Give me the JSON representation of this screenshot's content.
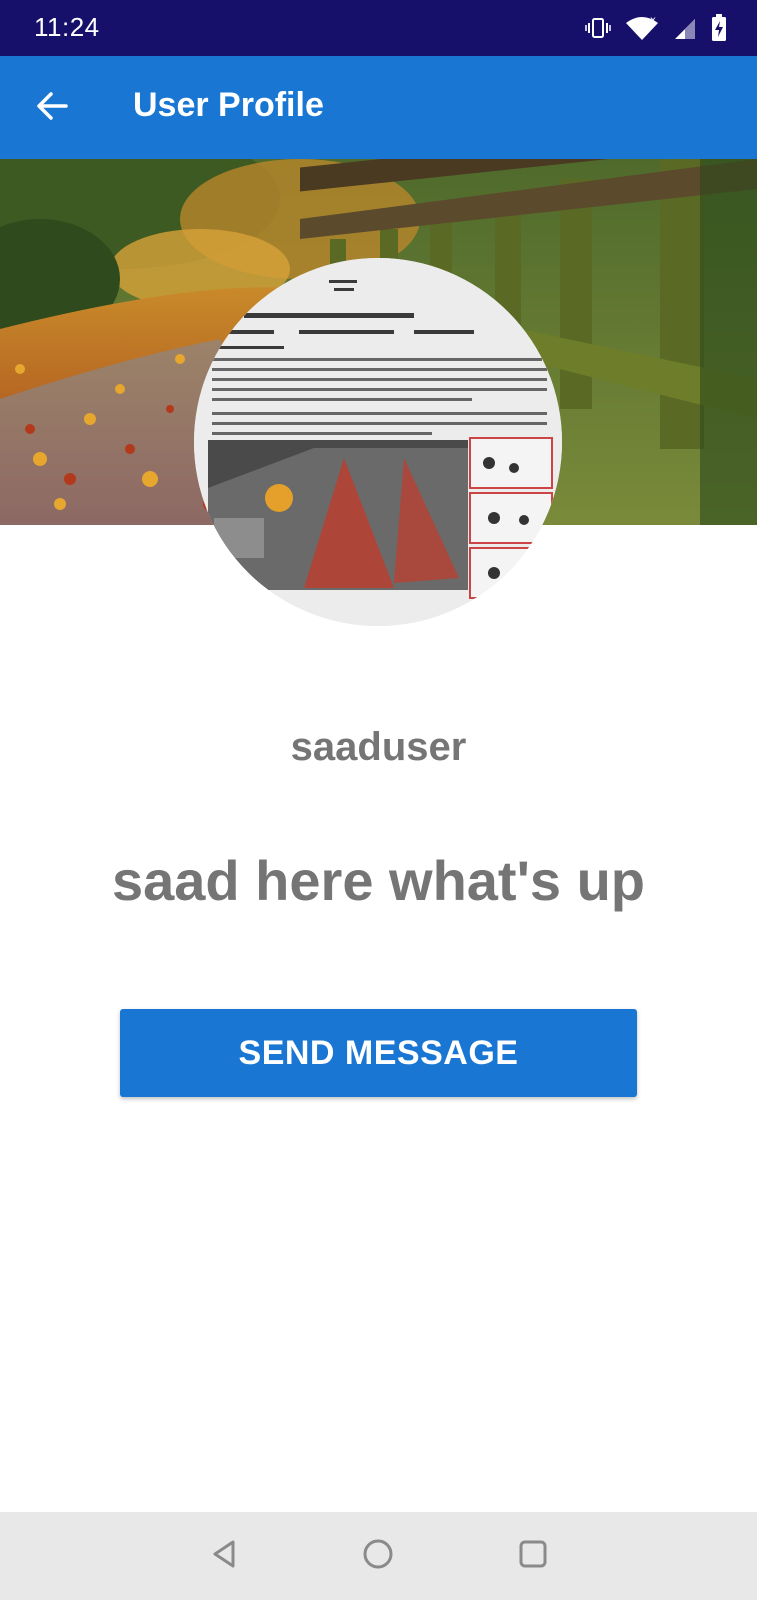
{
  "status_bar": {
    "time": "11:24",
    "icons": [
      "vibrate-icon",
      "wifi-icon",
      "signal-icon",
      "battery-charging-icon"
    ]
  },
  "app_bar": {
    "title": "User Profile",
    "back_icon": "arrow-back-icon"
  },
  "profile": {
    "cover_image": "autumn-path-fence-photo",
    "avatar_image": "airbag-recall-letter-photo",
    "username": "saaduser",
    "status": "saad here what's up"
  },
  "actions": {
    "send_message_label": "SEND MESSAGE"
  },
  "nav_bar": {
    "icons": [
      "back-triangle-icon",
      "home-circle-icon",
      "recents-square-icon"
    ]
  },
  "colors": {
    "status_bar": "#17106a",
    "primary": "#1976d2",
    "text_gray": "#757575",
    "nav_bar": "#e8e8e8"
  }
}
